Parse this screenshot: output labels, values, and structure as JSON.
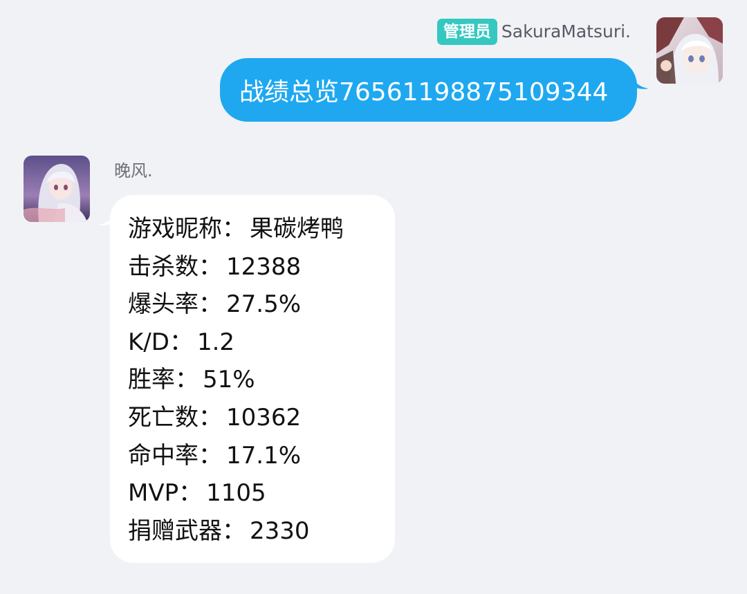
{
  "colors": {
    "background": "#f1f2f6",
    "outgoing_bubble": "#1fa8f0",
    "incoming_bubble": "#ffffff",
    "role_badge": "#35c8c1"
  },
  "outgoing_message": {
    "role_badge": "管理员",
    "sender_name": "SakuraMatsuri.",
    "avatar_icon": "anime-avatar-icon",
    "text": "战绩总览76561198875109344"
  },
  "incoming_message": {
    "sender_name": "晚风.",
    "avatar_icon": "anime-avatar-icon",
    "separator": "：",
    "stats": [
      {
        "label": "游戏昵称",
        "value": "果碳烤鸭"
      },
      {
        "label": "击杀数",
        "value": "12388"
      },
      {
        "label": "爆头率",
        "value": "27.5%"
      },
      {
        "label": "K/D",
        "value": "1.2"
      },
      {
        "label": "胜率",
        "value": "51%"
      },
      {
        "label": "死亡数",
        "value": "10362"
      },
      {
        "label": "命中率",
        "value": "17.1%"
      },
      {
        "label": "MVP",
        "value": "1105"
      },
      {
        "label": "捐赠武器",
        "value": "2330"
      }
    ]
  }
}
